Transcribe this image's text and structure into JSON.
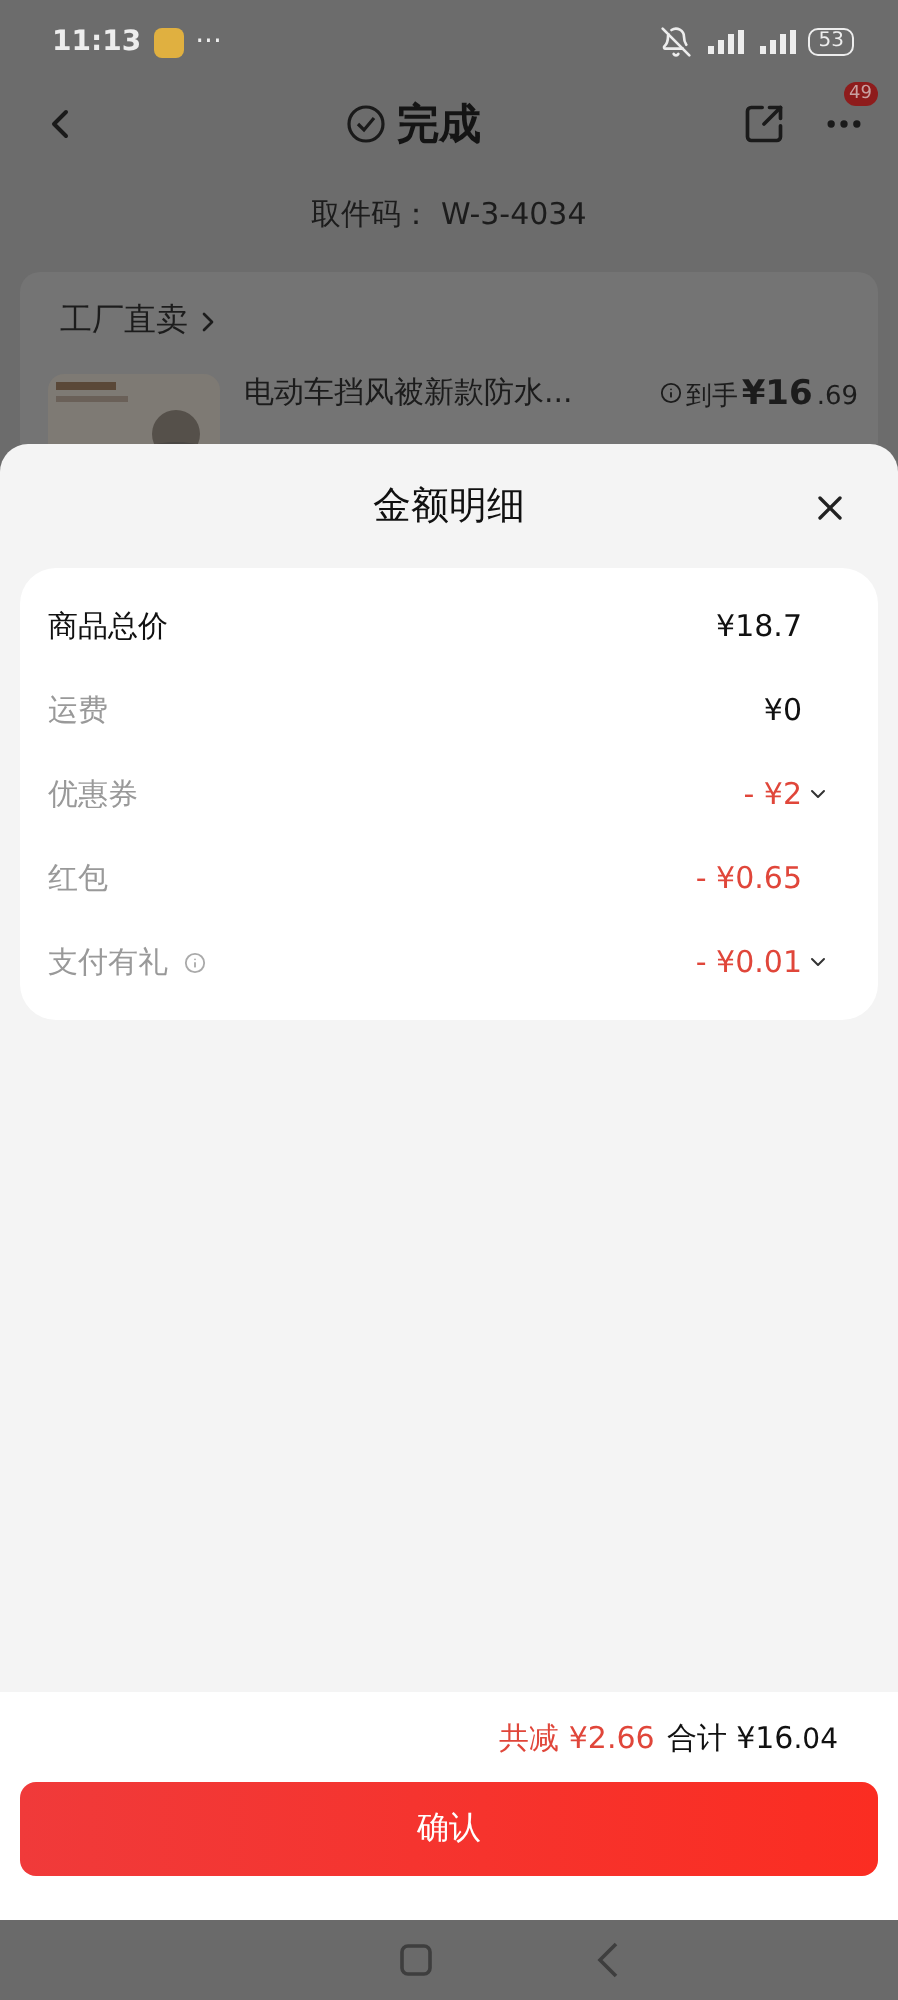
{
  "status_bar": {
    "time": "11:13",
    "more": "···",
    "battery": "53"
  },
  "header": {
    "title": "完成",
    "badge": "49"
  },
  "pickup": {
    "label": "取件码：",
    "code": "W-3-4034"
  },
  "store": {
    "name": "工厂直卖",
    "product": {
      "title": "电动车挡风被新款防水...",
      "price_label": "到手",
      "price_int": "¥16",
      "price_dec": ".69"
    }
  },
  "sheet": {
    "title": "金额明细",
    "rows": [
      {
        "label": "商品总价",
        "value": "¥18.7",
        "kind": "total",
        "expandable": false,
        "info": false
      },
      {
        "label": "运费",
        "value": "¥0",
        "kind": "normal",
        "expandable": false,
        "info": false
      },
      {
        "label": "优惠券",
        "value": "- ¥2",
        "kind": "discount",
        "expandable": true,
        "info": false
      },
      {
        "label": "红包",
        "value": "- ¥0.65",
        "kind": "discount",
        "expandable": false,
        "info": false
      },
      {
        "label": "支付有礼",
        "value": "- ¥0.01",
        "kind": "discount",
        "expandable": true,
        "info": true
      }
    ]
  },
  "footer": {
    "discount_label": "共减",
    "discount": "¥2.66",
    "total_label": "合计",
    "total_int": "¥16",
    "total_dec": ".04",
    "confirm": "确认"
  }
}
